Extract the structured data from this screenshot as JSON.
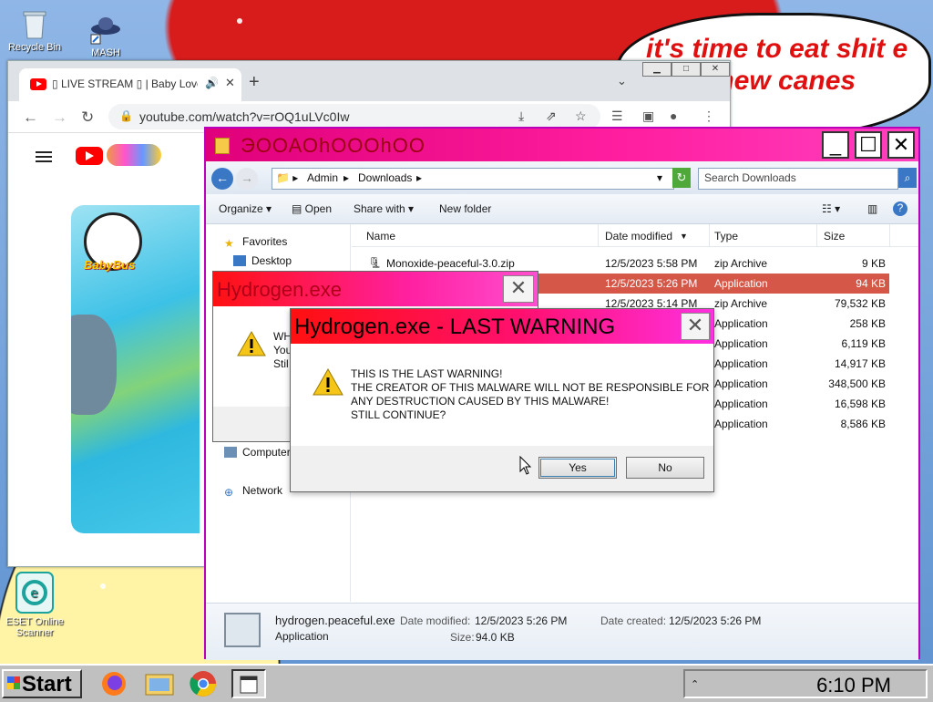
{
  "wallpaper": {
    "speech_text": "it's time to eat shit e and chew canes"
  },
  "desktop": {
    "icons": [
      {
        "label": "Recycle Bin",
        "icon": "recycle-bin-icon"
      },
      {
        "label": "MASH",
        "icon": "ufo-shortcut-icon"
      },
      {
        "label": "ESET Online Scanner",
        "icon": "eset-scanner-icon"
      }
    ]
  },
  "chrome": {
    "tab_title": "▯ LIVE STREAM ▯ | Baby Love",
    "url": "youtube.com/watch?v=rOQ1uLVc0Iw",
    "colors": {
      "youtube_red": "#ff0000"
    }
  },
  "explorer": {
    "title": "ЭΟΟΑΟhΟΟΟhΟΟ",
    "breadcrumb": [
      "Admin",
      "Downloads"
    ],
    "search_placeholder": "Search Downloads",
    "commands": [
      "Organize",
      "Open",
      "Share with",
      "New folder"
    ],
    "nav": [
      {
        "label": "Favorites",
        "icon": "star-icon"
      },
      {
        "label": "Desktop",
        "icon": "desktop-icon"
      },
      {
        "label": "Computer",
        "icon": "computer-icon"
      },
      {
        "label": "Network",
        "icon": "network-icon"
      }
    ],
    "columns": [
      "Name",
      "Date modified",
      "Type",
      "Size"
    ],
    "files": [
      {
        "name": "Monoxide-peaceful-3.0.zip",
        "date": "12/5/2023 5:58 PM",
        "type": "zip Archive",
        "size": "9 KB"
      },
      {
        "name": "",
        "date": "12/5/2023 5:26 PM",
        "type": "Application",
        "size": "94 KB"
      },
      {
        "name": "",
        "date": "12/5/2023 5:14 PM",
        "type": "zip Archive",
        "size": "79,532 KB"
      },
      {
        "name": "",
        "date": "",
        "type": "Application",
        "size": "258 KB"
      },
      {
        "name": "",
        "date": "",
        "type": "Application",
        "size": "6,119 KB"
      },
      {
        "name": "",
        "date": "",
        "type": "Application",
        "size": "14,917 KB"
      },
      {
        "name": "",
        "date": "",
        "type": "Application",
        "size": "348,500 KB"
      },
      {
        "name": "",
        "date": "",
        "type": "Application",
        "size": "16,598 KB"
      },
      {
        "name": "",
        "date": "",
        "type": "Application",
        "size": "8,586 KB"
      }
    ],
    "selected_index": 1,
    "details": {
      "filename": "hydrogen.peaceful.exe",
      "type": "Application",
      "modified_label": "Date modified:",
      "modified": "12/5/2023 5:26 PM",
      "size_label": "Size:",
      "size": "94.0 KB",
      "created_label": "Date created:",
      "created": "12/5/2023 5:26 PM"
    }
  },
  "dialog_back": {
    "title": "Hydrogen.exe",
    "lines": [
      "WH",
      "You",
      "Stil"
    ]
  },
  "dialog_front": {
    "title": "Hydrogen.exe - LAST WARNING",
    "lines": [
      "THIS IS THE LAST WARNING!",
      "THE CREATOR OF THIS MALWARE WILL NOT BE RESPONSIBLE FOR",
      "ANY DESTRUCTION CAUSED BY THIS MALWARE!",
      "STILL CONTINUE?"
    ],
    "yes_label": "Yes",
    "no_label": "No"
  },
  "taskbar": {
    "start_label": "Start",
    "apps": [
      "firefox-icon",
      "file-manager-icon",
      "chrome-icon",
      "app-window-icon"
    ],
    "clock": "6:10 PM"
  }
}
